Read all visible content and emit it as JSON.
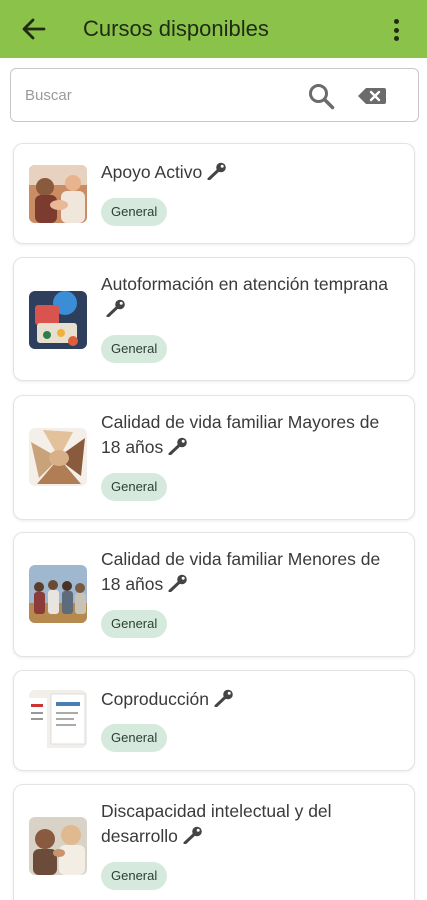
{
  "appbar": {
    "title": "Cursos disponibles",
    "back_icon": "arrow-back-icon",
    "menu_icon": "more-vert-icon",
    "color": "#8bc34a"
  },
  "search": {
    "placeholder": "Buscar",
    "value": "",
    "search_icon": "search-icon",
    "clear_icon": "backspace-icon"
  },
  "courses": [
    {
      "title": "Apoyo Activo",
      "badge": "General",
      "locked": true
    },
    {
      "title": "Autoformación en atención temprana",
      "badge": "General",
      "locked": true
    },
    {
      "title": "Calidad de vida familiar Mayores de 18 años",
      "badge": "General",
      "locked": true
    },
    {
      "title": "Calidad de vida familiar Menores de 18 años",
      "badge": "General",
      "locked": true
    },
    {
      "title": "Coproducción",
      "badge": "General",
      "locked": true
    },
    {
      "title": "Discapacidad intelectual y del desarrollo",
      "badge": "General",
      "locked": true
    }
  ],
  "colors": {
    "badge_bg": "#d6e9dd",
    "card_border": "#e3e3e3"
  }
}
